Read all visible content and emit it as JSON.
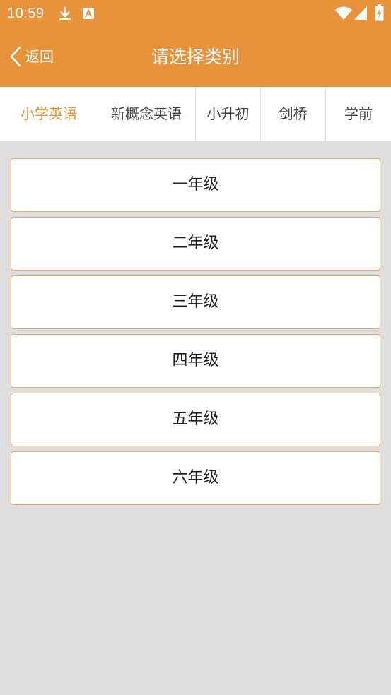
{
  "status_bar": {
    "time": "10:59",
    "icons": [
      "download-icon",
      "font-a-icon",
      "wifi-icon",
      "cellular-signal-icon",
      "battery-charging-icon"
    ]
  },
  "header": {
    "back_label": "返回",
    "title": "请选择类别",
    "background_color": "#e8923a"
  },
  "tabs": [
    {
      "label": "小学英语",
      "active": true
    },
    {
      "label": "新概念英语",
      "active": false
    },
    {
      "label": "小升初",
      "active": false
    },
    {
      "label": "剑桥",
      "active": false
    },
    {
      "label": "学前",
      "active": false
    }
  ],
  "accent_color": "#e8923a",
  "grades": [
    {
      "label": "一年级"
    },
    {
      "label": "二年级"
    },
    {
      "label": "三年级"
    },
    {
      "label": "四年级"
    },
    {
      "label": "五年级"
    },
    {
      "label": "六年级"
    }
  ]
}
